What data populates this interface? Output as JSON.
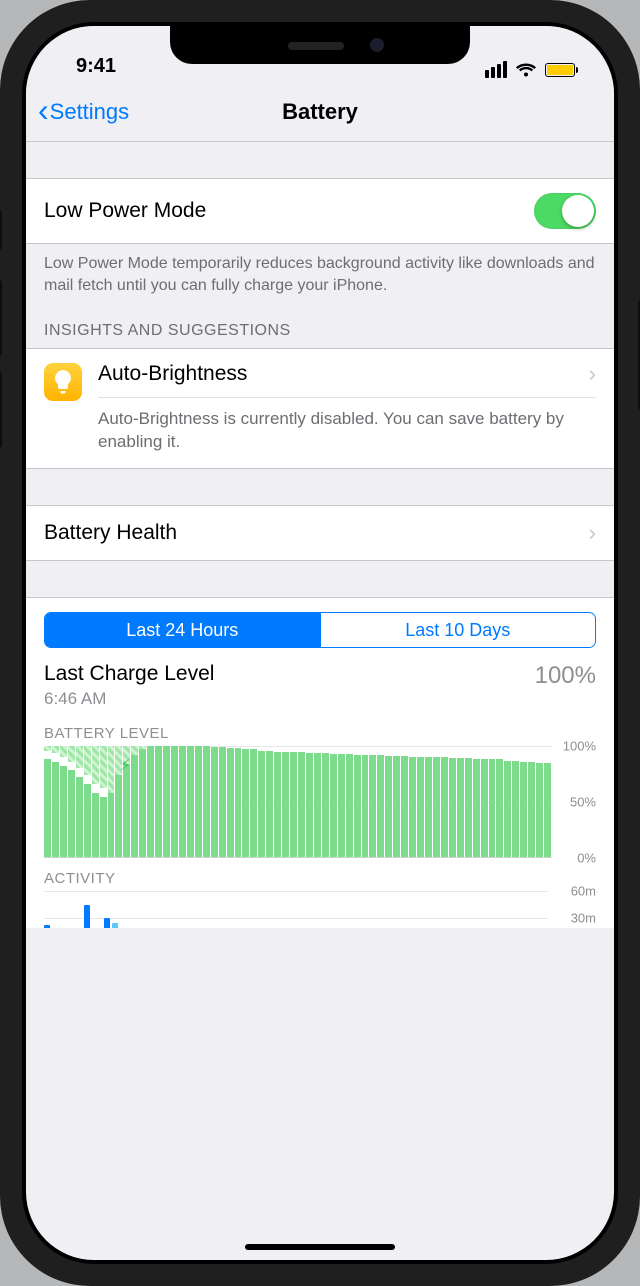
{
  "status": {
    "time": "9:41"
  },
  "nav": {
    "back_label": "Settings",
    "title": "Battery"
  },
  "low_power": {
    "label": "Low Power Mode",
    "enabled": true,
    "description": "Low Power Mode temporarily reduces background activity like downloads and mail fetch until you can fully charge your iPhone."
  },
  "insights": {
    "header": "INSIGHTS AND SUGGESTIONS",
    "item": {
      "icon": "lightbulb-icon",
      "title": "Auto-Brightness",
      "description": "Auto-Brightness is currently disabled. You can save battery by enabling it."
    }
  },
  "battery_health": {
    "label": "Battery Health"
  },
  "usage": {
    "tabs": [
      "Last 24 Hours",
      "Last 10 Days"
    ],
    "active_tab_index": 0,
    "last_charge": {
      "label": "Last Charge Level",
      "time": "6:46 AM",
      "percent": "100%"
    },
    "battery_level": {
      "title": "BATTERY LEVEL",
      "ylabels": [
        "100%",
        "50%",
        "0%"
      ]
    },
    "activity": {
      "title": "ACTIVITY",
      "ylabels": [
        "60m",
        "30m"
      ]
    }
  },
  "chart_data": {
    "battery_level": {
      "type": "bar",
      "ylim": [
        0,
        100
      ],
      "ylabel": "Battery %",
      "series": [
        {
          "name": "level",
          "values": [
            88,
            86,
            82,
            78,
            72,
            66,
            58,
            54,
            58,
            74,
            84,
            92,
            97,
            100,
            100,
            100,
            100,
            100,
            100,
            100,
            100,
            99,
            99,
            98,
            98,
            97,
            97,
            96,
            96,
            95,
            95,
            95,
            95,
            94,
            94,
            94,
            93,
            93,
            93,
            92,
            92,
            92,
            92,
            91,
            91,
            91,
            90,
            90,
            90,
            90,
            90,
            89,
            89,
            89,
            88,
            88,
            88,
            88,
            87,
            87,
            86,
            86,
            85,
            85
          ]
        },
        {
          "name": "charging",
          "values": [
            0,
            0,
            0,
            0,
            0,
            0,
            0,
            0,
            1,
            1,
            1,
            1,
            1,
            0,
            0,
            0,
            0,
            0,
            0,
            0,
            0,
            0,
            0,
            0,
            0,
            0,
            0,
            0,
            0,
            0,
            0,
            0,
            0,
            0,
            0,
            0,
            0,
            0,
            0,
            0,
            0,
            0,
            0,
            0,
            0,
            0,
            0,
            0,
            0,
            0,
            0,
            0,
            0,
            0,
            0,
            0,
            0,
            0,
            0,
            0,
            0,
            0,
            0,
            0
          ]
        }
      ]
    },
    "activity": {
      "type": "bar",
      "ylim": [
        0,
        60
      ],
      "ylabel": "minutes",
      "series": [
        {
          "name": "screen_on",
          "color": "#007aff",
          "values": [
            22,
            8,
            45,
            30,
            5,
            0,
            0,
            0,
            0,
            0,
            0,
            0,
            0,
            0,
            0,
            6,
            0,
            0,
            0,
            0,
            0,
            0,
            0,
            0
          ]
        },
        {
          "name": "screen_off",
          "color": "#5ac8fa",
          "values": [
            6,
            4,
            12,
            24,
            2,
            0,
            0,
            0,
            0,
            0,
            0,
            0,
            0,
            0,
            0,
            10,
            0,
            0,
            0,
            0,
            0,
            0,
            0,
            0
          ]
        }
      ]
    }
  }
}
